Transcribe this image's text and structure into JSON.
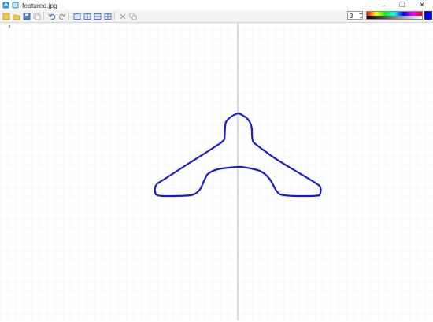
{
  "window": {
    "title": "featured.jpg",
    "controls": [
      "–",
      "❐",
      "✕"
    ]
  },
  "toolbar": {
    "buttons": [
      {
        "name": "new-icon"
      },
      {
        "name": "open-icon"
      },
      {
        "name": "save-icon"
      },
      {
        "name": "copy-icon"
      },
      {
        "name": "undo-icon"
      },
      {
        "name": "redo-icon"
      },
      {
        "name": "layout-single-icon"
      },
      {
        "name": "layout-split-vertical-icon"
      },
      {
        "name": "layout-split-horizontal-icon"
      },
      {
        "name": "layout-quad-icon"
      },
      {
        "name": "delete-icon"
      },
      {
        "name": "duplicate-icon"
      }
    ],
    "pen_size": "3"
  },
  "colors": {
    "current": "#0000ff",
    "stroke": "#1a1ad0",
    "grid": "#e6e6e6",
    "axis": "#b8b8b8"
  }
}
